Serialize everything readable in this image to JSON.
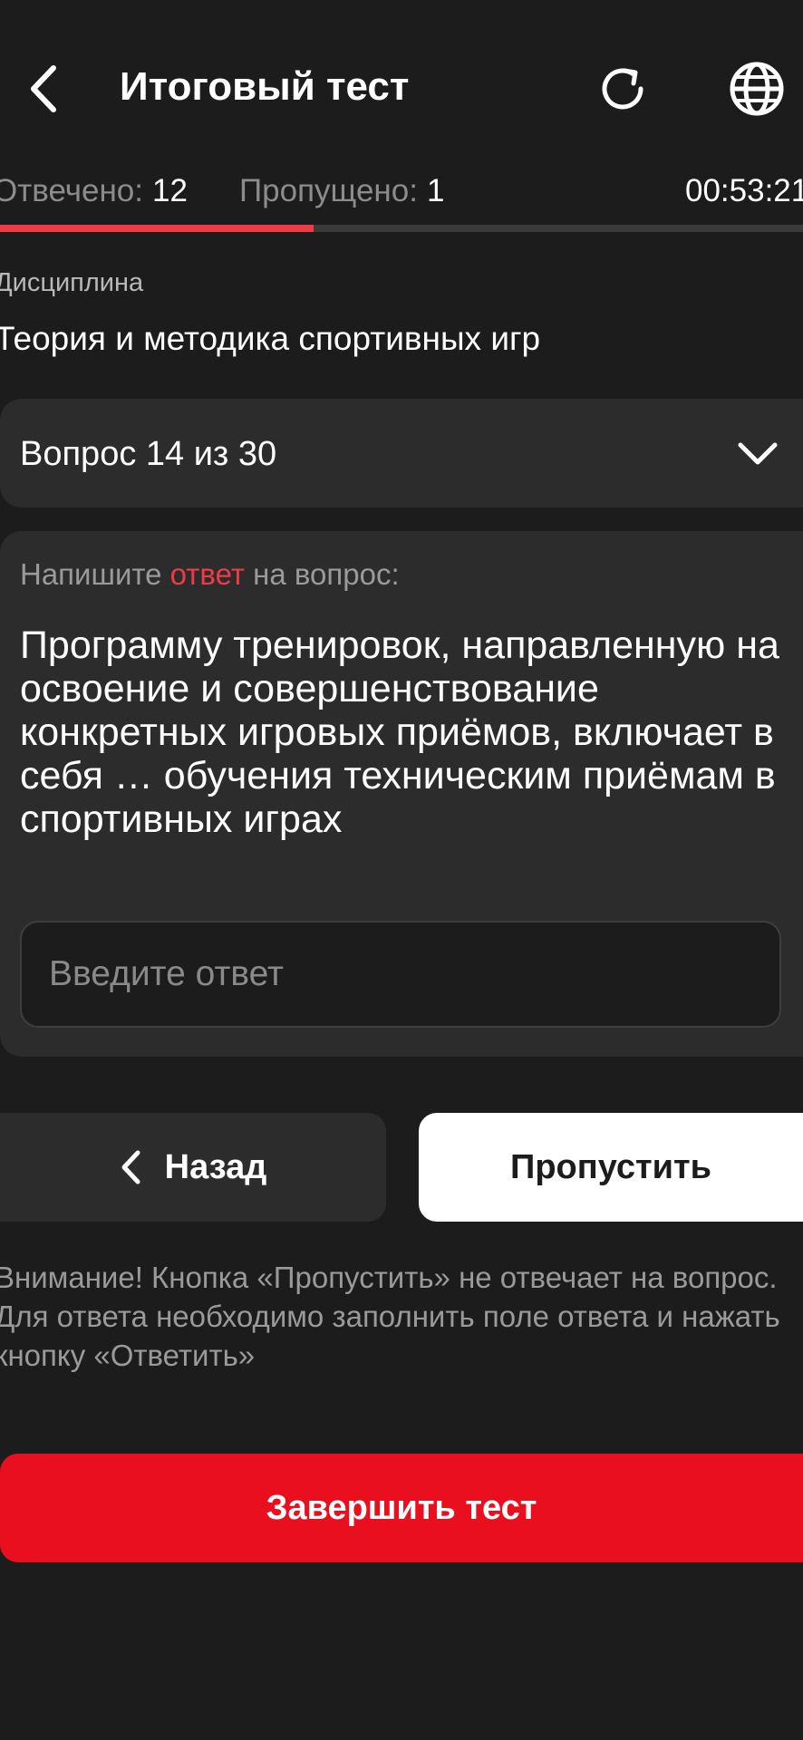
{
  "header": {
    "title": "Итоговый тест",
    "back_icon": "chevron-left-icon",
    "refresh_icon": "refresh-icon",
    "language_icon": "globe-icon"
  },
  "stats": {
    "answered_label": "Отвечено:",
    "answered_value": "12",
    "skipped_label": "Пропущено:",
    "skipped_value": "1",
    "timer": "00:53:21",
    "progress_fraction": 0.39
  },
  "discipline": {
    "label": "Дисциплина",
    "value": "Теория и методика спортивных игр"
  },
  "question_selector": {
    "label": "Вопрос 14 из 30",
    "icon": "chevron-down-icon"
  },
  "question": {
    "prompt_before": "Напишите ",
    "prompt_accent": "ответ",
    "prompt_after": " на вопрос:",
    "text": "Программу тренировок, направленную на освоение и совершенствование конкретных игровых приёмов, включает в себя … обучения техническим приёмам в спортивных играх",
    "input_value": "",
    "input_placeholder": "Введите ответ"
  },
  "actions": {
    "back_label": "Назад",
    "skip_label": "Пропустить",
    "finish_label": "Завершить тест"
  },
  "warning": "Внимание! Кнопка «Пропустить» не отвечает на вопрос. Для ответа необходимо заполнить поле ответа и нажать кнопку «Ответить»",
  "colors": {
    "background": "#1c1c1c",
    "surface": "#2c2c2c",
    "accent_red": "#ea0f1f",
    "progress_red": "#ef3b45"
  }
}
